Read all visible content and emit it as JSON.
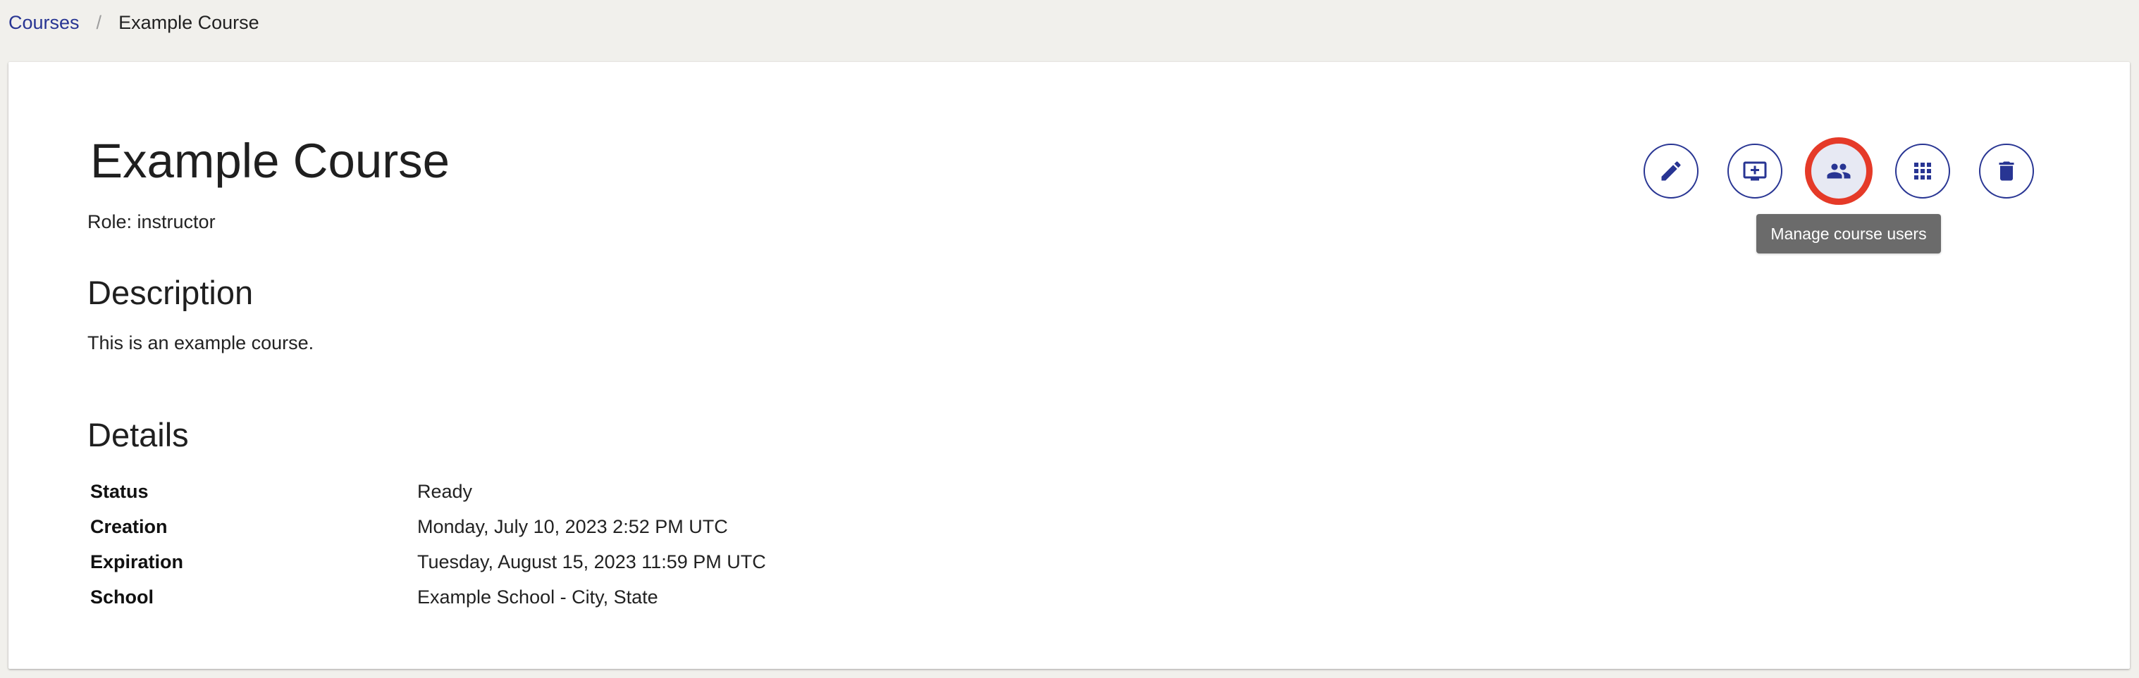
{
  "breadcrumb": {
    "courses": "Courses",
    "separator": "/",
    "current": "Example Course"
  },
  "course": {
    "title": "Example Course",
    "role": "Role: instructor"
  },
  "description": {
    "heading": "Description",
    "text": "This is an example course."
  },
  "details": {
    "heading": "Details",
    "rows": [
      {
        "label": "Status",
        "value": "Ready"
      },
      {
        "label": "Creation",
        "value": "Monday, July 10, 2023 2:52 PM UTC"
      },
      {
        "label": "Expiration",
        "value": "Tuesday, August 15, 2023 11:59 PM UTC"
      },
      {
        "label": "School",
        "value": "Example School - City, State"
      }
    ]
  },
  "actions": {
    "buttons": [
      {
        "name": "edit",
        "icon": "pencil-icon"
      },
      {
        "name": "present",
        "icon": "present-to-all-icon"
      },
      {
        "name": "manage-users",
        "icon": "people-icon",
        "highlighted": true
      },
      {
        "name": "apps",
        "icon": "grid-icon"
      },
      {
        "name": "delete",
        "icon": "trash-icon"
      }
    ],
    "tooltip": "Manage course users"
  },
  "colors": {
    "page_background": "#f1f0ec",
    "accent": "#283593",
    "highlight_ring": "#e53a28",
    "tooltip_background": "#6b6b6b"
  }
}
